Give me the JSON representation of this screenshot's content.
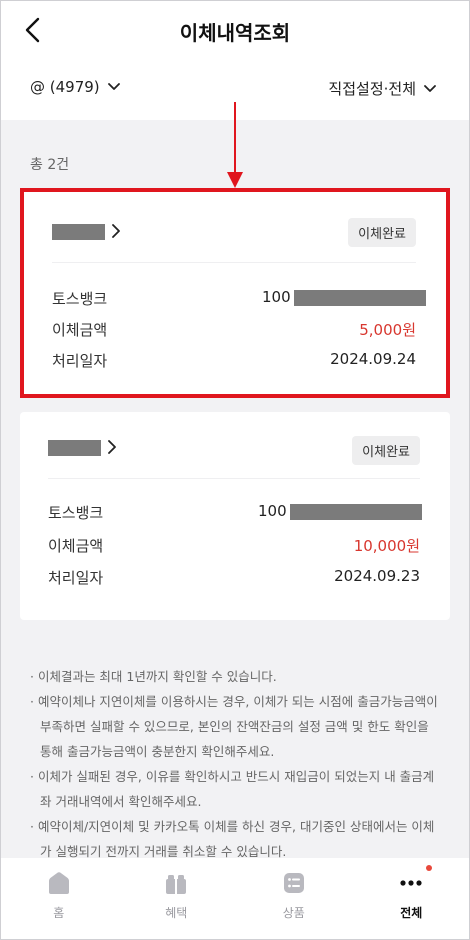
{
  "header": {
    "title": "이체내역조회",
    "account_label": "@ (4979)",
    "filter_label": "직접설정·전체"
  },
  "summary": {
    "count_label": "총 2건"
  },
  "transfers": [
    {
      "status": "이체완료",
      "bank": "토스뱅크",
      "account_prefix": "100",
      "amount_label": "이체금액",
      "amount": "5,000원",
      "date_label": "처리일자",
      "date": "2024.09.24",
      "highlighted": true
    },
    {
      "status": "이체완료",
      "bank": "토스뱅크",
      "account_prefix": "100",
      "amount_label": "이체금액",
      "amount": "10,000원",
      "date_label": "처리일자",
      "date": "2024.09.23",
      "highlighted": false
    }
  ],
  "notes": [
    "· 이체결과는 최대 1년까지 확인할 수 있습니다.",
    "· 예약이체나 지연이체를 이용하시는 경우, 이체가 되는 시점에 출금가능금액이 부족하면 실패할 수 있으므로, 본인의 잔액잔금의 설정 금액 및 한도 확인을 통해 출금가능금액이 충분한지 확인해주세요.",
    "· 이체가 실패된 경우, 이유를 확인하시고 반드시 재입금이 되었는지 내 출금계좌 거래내역에서 확인해주세요.",
    "· 예약이체/지연이체 및 카카오톡 이체를 하신 경우, 대기중인 상태에서는 이체가 실행되기 전까지 거래를 취소할 수 있습니다."
  ],
  "tabbar": {
    "items": [
      {
        "label": "홈",
        "icon": "home-icon",
        "active": false
      },
      {
        "label": "혜택",
        "icon": "gift-icon",
        "active": false
      },
      {
        "label": "상품",
        "icon": "products-icon",
        "active": false
      },
      {
        "label": "전체",
        "icon": "more-icon",
        "active": true,
        "notification": true
      }
    ]
  },
  "colors": {
    "accent_red": "#e0161e",
    "amount_red": "#d8372f",
    "notification_dot": "#e8483b"
  }
}
